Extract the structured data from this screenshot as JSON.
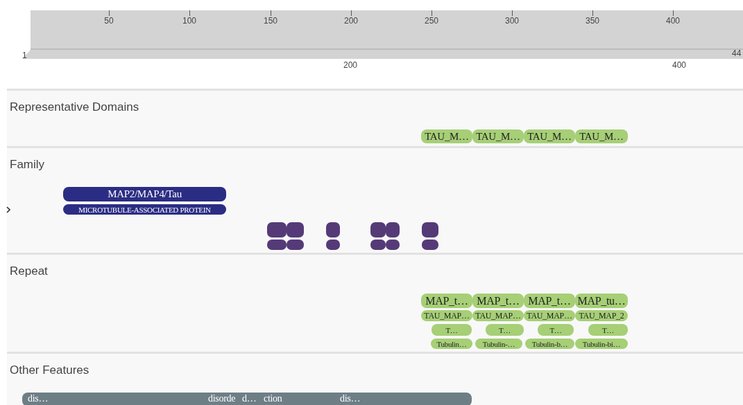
{
  "ruler": {
    "ticks": [
      "50",
      "100",
      "150",
      "200",
      "250",
      "300",
      "350",
      "400"
    ],
    "start": "1",
    "end": "44",
    "overview_ticks": [
      "200",
      "400"
    ]
  },
  "tracks": [
    {
      "title": "Representative Domains",
      "features": [
        {
          "kind": "pill",
          "label": "TAU_M…",
          "color": "#a6cf76"
        },
        {
          "kind": "pill",
          "label": "TAU_M…",
          "color": "#a6cf76"
        },
        {
          "kind": "pill",
          "label": "TAU_M…",
          "color": "#a6cf76"
        },
        {
          "kind": "pill",
          "label": "TAU_M…",
          "color": "#a6cf76"
        }
      ]
    },
    {
      "title": "Family",
      "features": [
        {
          "kind": "pill",
          "label": "MAP2/MAP4/Tau",
          "color": "#2b2d84"
        },
        {
          "kind": "pill",
          "label": "MICROTUBULE-ASSOCIATED PROTEIN",
          "color": "#2b2d84"
        },
        {
          "kind": "blob",
          "color": "#553a78"
        },
        {
          "kind": "blob",
          "color": "#553a78"
        },
        {
          "kind": "blob",
          "color": "#553a78"
        },
        {
          "kind": "blob",
          "color": "#553a78"
        },
        {
          "kind": "blob",
          "color": "#553a78"
        },
        {
          "kind": "blob",
          "color": "#553a78"
        },
        {
          "kind": "blob",
          "color": "#553a78"
        },
        {
          "kind": "blob",
          "color": "#553a78"
        },
        {
          "kind": "blob",
          "color": "#553a78"
        },
        {
          "kind": "blob",
          "color": "#553a78"
        },
        {
          "kind": "blob",
          "color": "#553a78"
        },
        {
          "kind": "blob",
          "color": "#553a78"
        }
      ]
    },
    {
      "title": "Repeat",
      "features": [
        {
          "kind": "pill",
          "label": "MAP_t…",
          "color": "#a6cf76"
        },
        {
          "kind": "pill",
          "label": "MAP_t…",
          "color": "#a6cf76"
        },
        {
          "kind": "pill",
          "label": "MAP_t…",
          "color": "#a6cf76"
        },
        {
          "kind": "pill",
          "label": "MAP_tu…",
          "color": "#a6cf76"
        },
        {
          "kind": "pill",
          "label": "TAU_MAP…",
          "color": "#a6cf76"
        },
        {
          "kind": "pill",
          "label": "TAU_MAP…",
          "color": "#a6cf76"
        },
        {
          "kind": "pill",
          "label": "TAU_MAP…",
          "color": "#a6cf76"
        },
        {
          "kind": "pill",
          "label": "TAU_MAP_2",
          "color": "#a6cf76"
        },
        {
          "kind": "pill",
          "label": "T…",
          "color": "#a6cf76"
        },
        {
          "kind": "pill",
          "label": "T…",
          "color": "#a6cf76"
        },
        {
          "kind": "pill",
          "label": "T…",
          "color": "#a6cf76"
        },
        {
          "kind": "pill",
          "label": "T…",
          "color": "#a6cf76"
        },
        {
          "kind": "pill",
          "label": "Tubulin…",
          "color": "#a6cf76"
        },
        {
          "kind": "pill",
          "label": "Tubulin-…",
          "color": "#a6cf76"
        },
        {
          "kind": "pill",
          "label": "Tubulin-b…",
          "color": "#a6cf76"
        },
        {
          "kind": "pill",
          "label": "Tubulin-bi…",
          "color": "#a6cf76"
        }
      ]
    },
    {
      "title": "Other Features",
      "features": [
        {
          "kind": "bar",
          "color": "#6e7e85",
          "labels": [
            "dis…",
            "disorde",
            "d…",
            "ction",
            "dis…"
          ]
        }
      ]
    }
  ]
}
